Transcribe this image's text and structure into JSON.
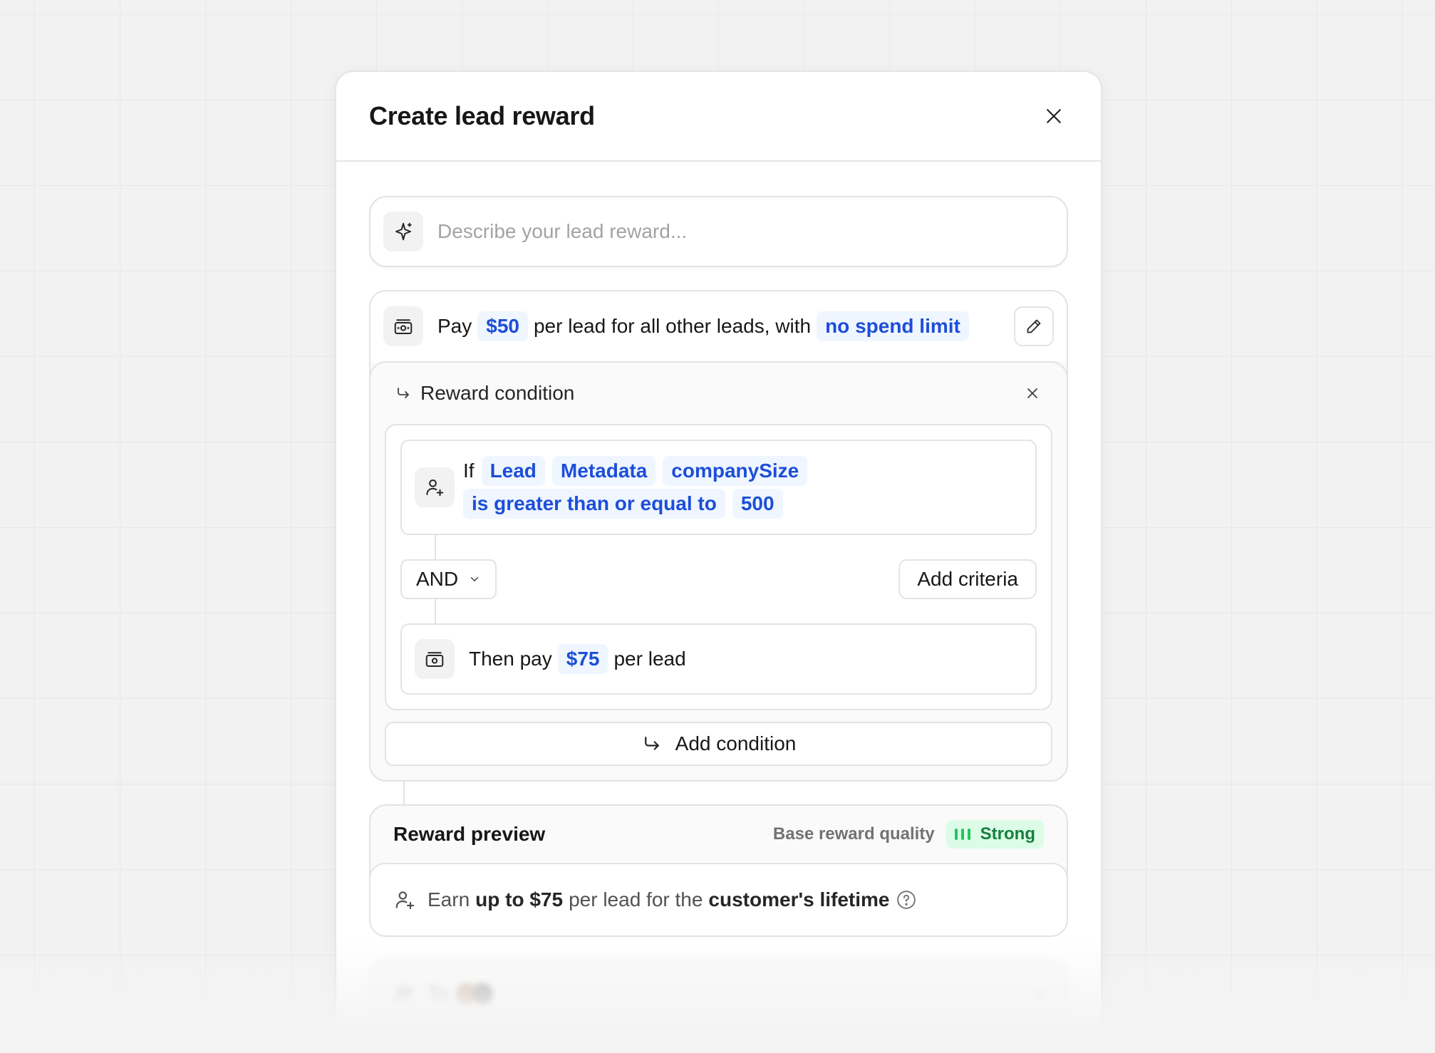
{
  "modal": {
    "title": "Create lead reward"
  },
  "prompt": {
    "placeholder": "Describe your lead reward..."
  },
  "reward": {
    "pay_word": "Pay",
    "amount": "$50",
    "middle_text": "per lead for all other leads, with",
    "limit": "no spend limit"
  },
  "condition": {
    "title": "Reward condition",
    "if_word": "If",
    "entity": "Lead",
    "source": "Metadata",
    "field": "companySize",
    "operator": "is greater than or equal to",
    "value": "500",
    "logic": "AND",
    "add_criteria_label": "Add criteria",
    "then_prefix": "Then pay",
    "then_amount": "$75",
    "then_suffix": "per lead",
    "add_condition_label": "Add condition"
  },
  "preview": {
    "title": "Reward preview",
    "quality_label": "Base reward quality",
    "quality_value": "Strong",
    "earn_prefix": "Earn",
    "earn_amount": "up to $75",
    "earn_middle": "per lead for the",
    "earn_duration": "customer's lifetime"
  },
  "ghost": {
    "text": "To"
  },
  "colors": {
    "accent_blue": "#1d4ed8",
    "chip_bg": "#eff6ff",
    "strong_green": "#15803d",
    "strong_bg": "#dcfce7"
  },
  "icons": {
    "close": "close-icon",
    "sparkle": "sparkle-icon",
    "money": "money-icon",
    "pencil": "pencil-icon",
    "arrow": "arrow-turn-icon",
    "user": "user-plus-icon",
    "chevron": "chevron-down-icon",
    "help": "help-circle-icon"
  }
}
